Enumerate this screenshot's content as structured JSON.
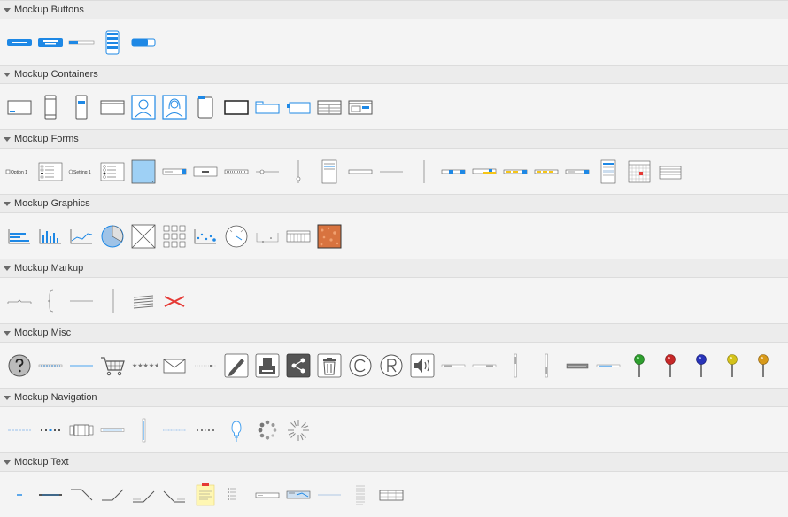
{
  "sections": [
    {
      "title": "Mockup Buttons"
    },
    {
      "title": "Mockup Containers"
    },
    {
      "title": "Mockup Forms",
      "texts": {
        "option": "Option 1",
        "setting": "Setting 1"
      }
    },
    {
      "title": "Mockup Graphics"
    },
    {
      "title": "Mockup Markup"
    },
    {
      "title": "Mockup Misc"
    },
    {
      "title": "Mockup Navigation"
    },
    {
      "title": "Mockup Text"
    }
  ],
  "colors": {
    "accent": "#1e88e5",
    "header_bg": "#ececec",
    "panel_bg": "#f4f4f4"
  }
}
